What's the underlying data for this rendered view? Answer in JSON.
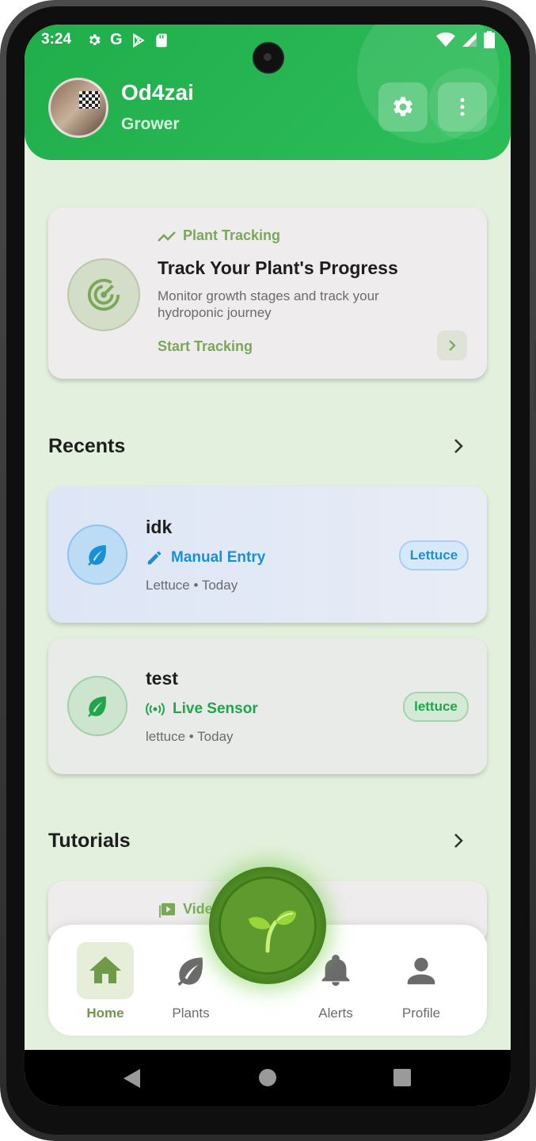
{
  "status_bar": {
    "time": "3:24",
    "left_icons": [
      "settings-icon",
      "google-icon",
      "play-store-icon",
      "sd-card-icon"
    ],
    "right_icons": [
      "wifi-icon",
      "signal-icon",
      "battery-icon"
    ]
  },
  "header": {
    "username": "Od4zai",
    "role": "Grower",
    "actions": [
      "settings-icon",
      "more-vert-icon"
    ],
    "colors": {
      "primary": "#22b04d"
    }
  },
  "tracking_card": {
    "tag": "Plant Tracking",
    "title": "Track Your Plant's Progress",
    "description": "Monitor growth stages and track your hydroponic journey",
    "cta": "Start Tracking"
  },
  "recents": {
    "title": "Recents",
    "items": [
      {
        "name": "idk",
        "source": "Manual Entry",
        "meta": "Lettuce • Today",
        "badge": "Lettuce",
        "color": "#1a8fd8"
      },
      {
        "name": "test",
        "source": "Live Sensor",
        "meta": "lettuce • Today",
        "badge": "lettuce",
        "color": "#22a44a"
      }
    ]
  },
  "tutorials": {
    "title": "Tutorials",
    "first_item_label": "Vide"
  },
  "bottom_nav": {
    "items": [
      {
        "label": "Home",
        "icon": "home-icon",
        "active": true
      },
      {
        "label": "Plants",
        "icon": "leaf-icon",
        "active": false
      },
      {
        "label": "Alerts",
        "icon": "bell-icon",
        "active": false
      },
      {
        "label": "Profile",
        "icon": "person-icon",
        "active": false
      }
    ],
    "center_icon": "sprout-icon"
  },
  "system_nav": [
    "back-icon",
    "home-circle-icon",
    "recents-square-icon"
  ]
}
